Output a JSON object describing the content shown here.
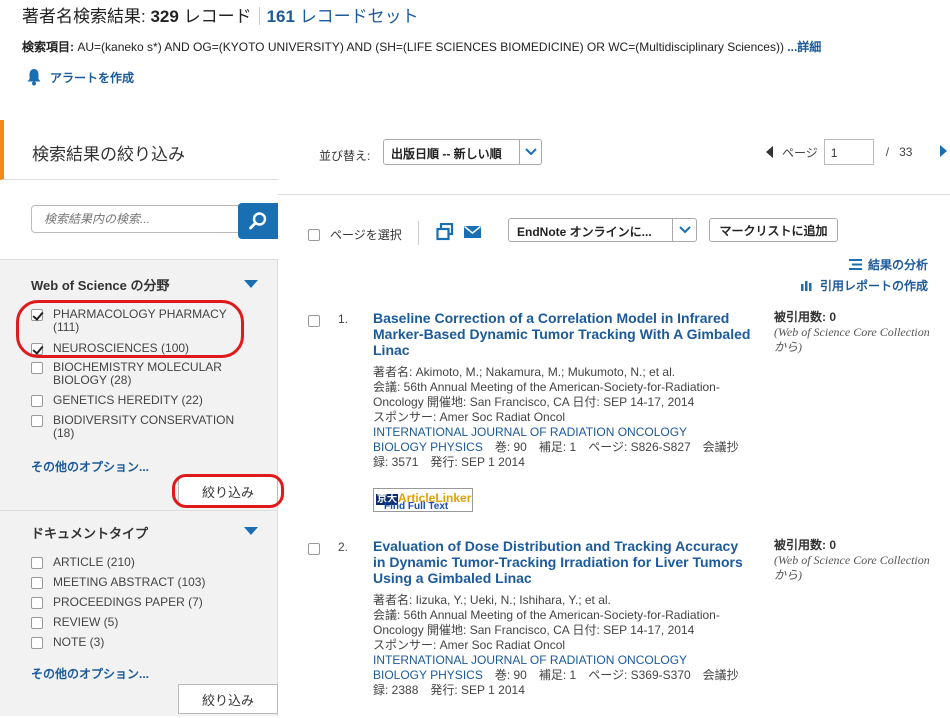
{
  "header": {
    "title_prefix": "著者名検索結果:",
    "record_count": "329",
    "records_suffix": "レコード",
    "set_count": "161",
    "sets_suffix": "レコードセット",
    "query_label": "検索項目:",
    "query_text": "AU=(kaneko s*) AND OG=(KYOTO UNIVERSITY) AND (SH=(LIFE SCIENCES BIOMEDICINE) OR WC=(Multidisciplinary Sciences))",
    "query_more": "...詳細",
    "alert_label": "アラートを作成"
  },
  "sidebar": {
    "title": "検索結果の絞り込み",
    "search_placeholder": "検索結果内の検索...",
    "wos_section": {
      "title": "Web of Science の分野",
      "items": [
        {
          "label": "PHARMACOLOGY PHARMACY",
          "count": "(111)",
          "checked": true
        },
        {
          "label": "NEUROSCIENCES",
          "count": "(100)",
          "checked": true
        },
        {
          "label": "BIOCHEMISTRY MOLECULAR",
          "count": "BIOLOGY (28)",
          "checked": false
        },
        {
          "label": "GENETICS HEREDITY",
          "count": "(22)",
          "checked": false
        },
        {
          "label": "BIODIVERSITY CONSERVATION",
          "count": "(18)",
          "checked": false
        }
      ],
      "more_options": "その他のオプション...",
      "refine_button": "絞り込み"
    },
    "doc_section": {
      "title": "ドキュメントタイプ",
      "items": [
        {
          "label": "ARTICLE (210)",
          "checked": false
        },
        {
          "label": "MEETING ABSTRACT (103)",
          "checked": false
        },
        {
          "label": "PROCEEDINGS PAPER (7)",
          "checked": false
        },
        {
          "label": "REVIEW (5)",
          "checked": false
        },
        {
          "label": "NOTE (3)",
          "checked": false
        }
      ],
      "more_options": "その他のオプション...",
      "refine_button": "絞り込み"
    }
  },
  "sortbar": {
    "label": "並び替え:",
    "selected": "出版日順 -- 新しい順",
    "page_label": "ページ",
    "page_value": "1",
    "page_sep": "/",
    "page_total": "33"
  },
  "toolbar": {
    "select_page": "ページを選択",
    "endnote": "EndNote オンラインに...",
    "marklist": "マークリストに追加",
    "analyze": "結果の分析",
    "citation_report": "引用レポートの作成"
  },
  "records": [
    {
      "num": "1.",
      "title": "Baseline Correction of a Correlation Model in Infrared Marker-Based Dynamic Tumor Tracking With A Gimbaled Linac",
      "authors": "著者名: Akimoto, M.; Nakamura, M.; Mukumoto, N.; et al.",
      "conference": "会議: 56th Annual Meeting of the American-Society-for-Radiation-Oncology 開催地: San Francisco, CA 日付: SEP 14-17, 2014",
      "sponsor": "スポンサー: Amer Soc Radiat Oncol",
      "journal": "INTERNATIONAL JOURNAL OF RADIATION ONCOLOGY BIOLOGY PHYSICS",
      "details": "巻: 90　補足: 1　ページ: S826-S827　会議抄録: 3571　発行: SEP 1 2014",
      "cited_label": "被引用数: 0",
      "cited_source": "(Web of Science Core Collection から)",
      "linker": {
        "k": "京大",
        "al": "ArticleLinker",
        "find": "Find Full Text"
      }
    },
    {
      "num": "2.",
      "title": "Evaluation of Dose Distribution and Tracking Accuracy in Dynamic Tumor-Tracking Irradiation for Liver Tumors Using a Gimbaled Linac",
      "authors": "著者名: Iizuka, Y.; Ueki, N.; Ishihara, Y.; et al.",
      "conference": "会議: 56th Annual Meeting of the American-Society-for-Radiation-Oncology 開催地: San Francisco, CA 日付: SEP 14-17, 2014",
      "sponsor": "スポンサー: Amer Soc Radiat Oncol",
      "journal": "INTERNATIONAL JOURNAL OF RADIATION ONCOLOGY BIOLOGY PHYSICS",
      "details": "巻: 90　補足: 1　ページ: S369-S370　会議抄録: 2388　発行: SEP 1 2014",
      "cited_label": "被引用数: 0",
      "cited_source": "(Web of Science Core Collection から)"
    }
  ],
  "colors": {
    "accent": "#1a6fb3",
    "link": "#1b5a9b",
    "highlight": "#e0191b",
    "tab_accent": "#ef8a1d"
  }
}
